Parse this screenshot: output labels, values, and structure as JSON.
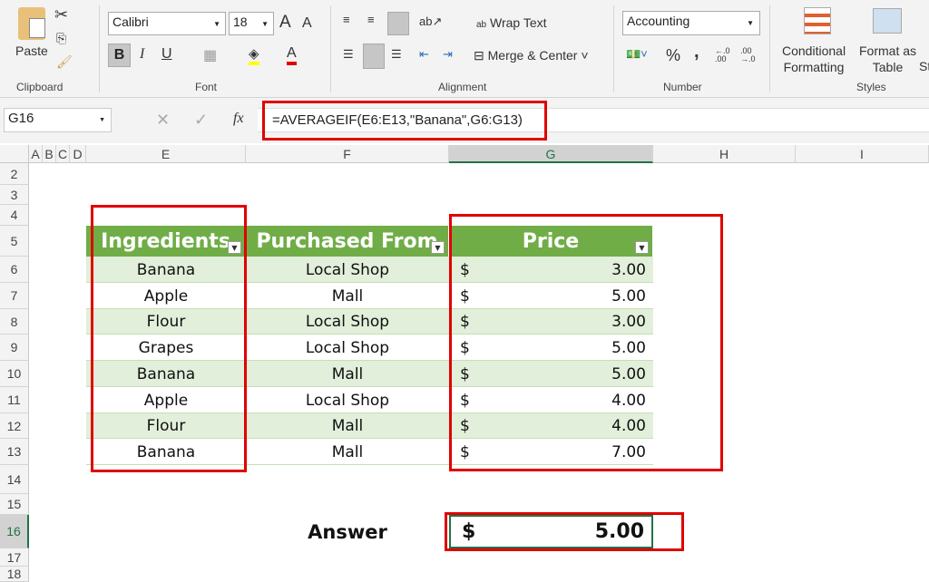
{
  "ribbon": {
    "clipboard": {
      "paste_label": "Paste",
      "group_label": "Clipboard"
    },
    "font": {
      "font_name": "Calibri",
      "font_size": "18",
      "bold": "B",
      "italic": "I",
      "underline": "U",
      "group_label": "Font"
    },
    "alignment": {
      "wrap_text": "Wrap Text",
      "merge_center": "Merge & Center",
      "group_label": "Alignment"
    },
    "number": {
      "format": "Accounting",
      "percent": "%",
      "comma": ",",
      "inc_decimal": "←.0 .00",
      "dec_decimal": ".00 →.0",
      "group_label": "Number"
    },
    "styles": {
      "conditional_formatting": [
        "Conditional",
        "Formatting"
      ],
      "format_as_table": [
        "Format as",
        "Table"
      ],
      "cell_styles_partial": "St",
      "group_label": "Styles"
    }
  },
  "formula_bar": {
    "name_box": "G16",
    "fx": "fx",
    "formula": "=AVERAGEIF(E6:E13,\"Banana\",G6:G13)"
  },
  "columns": [
    "A",
    "B",
    "C",
    "D",
    "E",
    "F",
    "G",
    "H",
    "I"
  ],
  "rows": [
    "2",
    "3",
    "4",
    "5",
    "6",
    "7",
    "8",
    "9",
    "10",
    "11",
    "12",
    "13",
    "14",
    "15",
    "16",
    "17",
    "18"
  ],
  "table": {
    "headers": [
      "Ingredients",
      "Purchased From",
      "Price"
    ],
    "rows": [
      {
        "ingredient": "Banana",
        "from": "Local Shop",
        "currency": "$",
        "price": "3.00"
      },
      {
        "ingredient": "Apple",
        "from": "Mall",
        "currency": "$",
        "price": "5.00"
      },
      {
        "ingredient": "Flour",
        "from": "Local Shop",
        "currency": "$",
        "price": "3.00"
      },
      {
        "ingredient": "Grapes",
        "from": "Local Shop",
        "currency": "$",
        "price": "5.00"
      },
      {
        "ingredient": "Banana",
        "from": "Mall",
        "currency": "$",
        "price": "5.00"
      },
      {
        "ingredient": "Apple",
        "from": "Local Shop",
        "currency": "$",
        "price": "4.00"
      },
      {
        "ingredient": "Flour",
        "from": "Mall",
        "currency": "$",
        "price": "4.00"
      },
      {
        "ingredient": "Banana",
        "from": "Mall",
        "currency": "$",
        "price": "7.00"
      }
    ],
    "header_color": "#70ad47",
    "band_color": "#e2efda"
  },
  "answer": {
    "label": "Answer",
    "currency": "$",
    "value": "5.00"
  },
  "highlight_color": "#e00000"
}
